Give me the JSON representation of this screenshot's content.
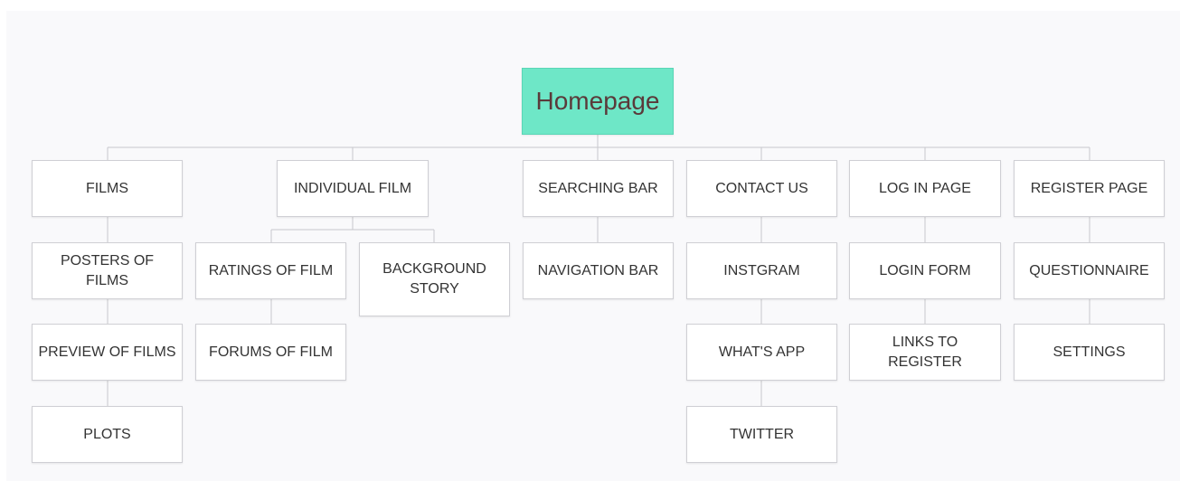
{
  "colors": {
    "root_fill": "#6ee7c7",
    "node_fill": "#ffffff",
    "node_border": "#cfcfd4",
    "connector": "#c8c8cc",
    "root_text": "#5a3a3a"
  },
  "root": {
    "label": "Homepage"
  },
  "columns": [
    {
      "label": "FILMS",
      "children": [
        "POSTERS OF FILMS",
        "PREVIEW OF FILMS",
        "PLOTS"
      ]
    },
    {
      "label": "INDIVIDUAL FILM",
      "children": [
        "RATINGS OF FILM",
        "FORUMS OF FILM",
        "BACKGROUND STORY"
      ]
    },
    {
      "label": "SEARCHING BAR",
      "children": [
        "NAVIGATION BAR"
      ]
    },
    {
      "label": "CONTACT US",
      "children": [
        "INSTGRAM",
        "WHAT'S APP",
        "TWITTER"
      ]
    },
    {
      "label": "LOG IN PAGE",
      "children": [
        "LOGIN FORM",
        "LINKS TO REGISTER"
      ]
    },
    {
      "label": "REGISTER PAGE",
      "children": [
        "QUESTIONNAIRE",
        "SETTINGS"
      ]
    }
  ]
}
